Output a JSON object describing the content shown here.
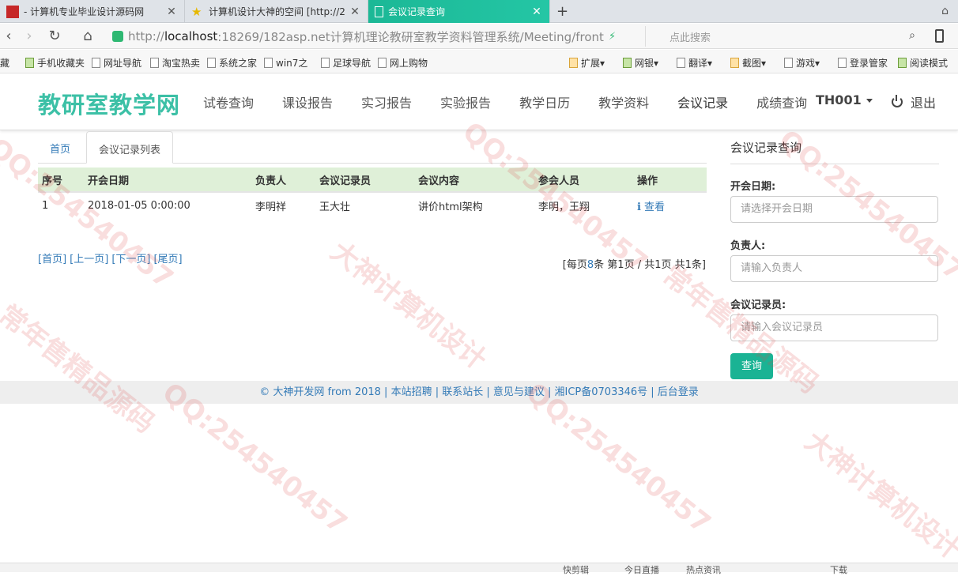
{
  "browser": {
    "tabs": [
      {
        "title": "- 计算机专业毕业设计源码网",
        "active": false
      },
      {
        "title": "计算机设计大神的空间 [http://2",
        "active": false
      },
      {
        "title": "会议记录查询",
        "active": true
      }
    ],
    "new_tab": "+",
    "url_scheme": "http://",
    "url_host": "localhost",
    "url_rest": ":18269/182asp.net计算机理论教研室教学资料管理系统/Meeting/front",
    "search_placeholder": "点此搜索",
    "bookmarks_left": [
      "藏",
      "手机收藏夹",
      "网址导航",
      "淘宝热卖",
      "系统之家",
      "win7之",
      "足球导航",
      "网上购物"
    ],
    "bookmarks_right": [
      "扩展",
      "网银",
      "翻译",
      "截图",
      "游戏",
      "登录管家",
      "阅读模式"
    ]
  },
  "site": {
    "brand": "教研室教学网",
    "nav": [
      "试卷查询",
      "课设报告",
      "实习报告",
      "实验报告",
      "教学日历",
      "教学资料",
      "会议记录",
      "成绩查询"
    ],
    "user": "TH001",
    "logout": "退出"
  },
  "content": {
    "tabs": [
      "首页",
      "会议记录列表"
    ],
    "table": {
      "headers": [
        "序号",
        "开会日期",
        "负责人",
        "会议记录员",
        "会议内容",
        "参会人员",
        "操作"
      ],
      "rows": [
        {
          "no": "1",
          "date": "2018-01-05 0:00:00",
          "leader": "李明祥",
          "recorder": "王大壮",
          "content": "讲价html架构",
          "attendees": "李明，王翔",
          "action": "查看"
        }
      ]
    },
    "pager": {
      "first": "[首页]",
      "prev": "[上一页]",
      "next": "[下一页]",
      "last": "[尾页]",
      "info_pre": "[每页",
      "per_page": "8",
      "info_mid": "条 第",
      "current": "1",
      "info_mid2": "页 / 共",
      "total_pages": "1",
      "info_mid3": "页 共",
      "total_count": "1",
      "info_post": "条]"
    }
  },
  "query": {
    "title": "会议记录查询",
    "date_label": "开会日期:",
    "date_placeholder": "请选择开会日期",
    "leader_label": "负责人:",
    "leader_placeholder": "请输入负责人",
    "recorder_label": "会议记录员:",
    "recorder_placeholder": "请输入会议记录员",
    "submit": "查询"
  },
  "footer": {
    "text": "© 大神开发网 from 2018 | 本站招聘 | 联系站长 | 意见与建议 | 湘ICP备0703346号 | 后台登录"
  },
  "watermarks": [
    "QQ:254540457",
    "大神计算机设计",
    "常年售精品源码"
  ],
  "statusbar": [
    "快剪辑",
    "今日直播",
    "热点资讯",
    "下载"
  ],
  "colors": {
    "brand": "#3cc0a6",
    "link": "#337ab7",
    "table_header": "#dff0d8",
    "button": "#1ab394",
    "active_tab": "#1bb896"
  }
}
